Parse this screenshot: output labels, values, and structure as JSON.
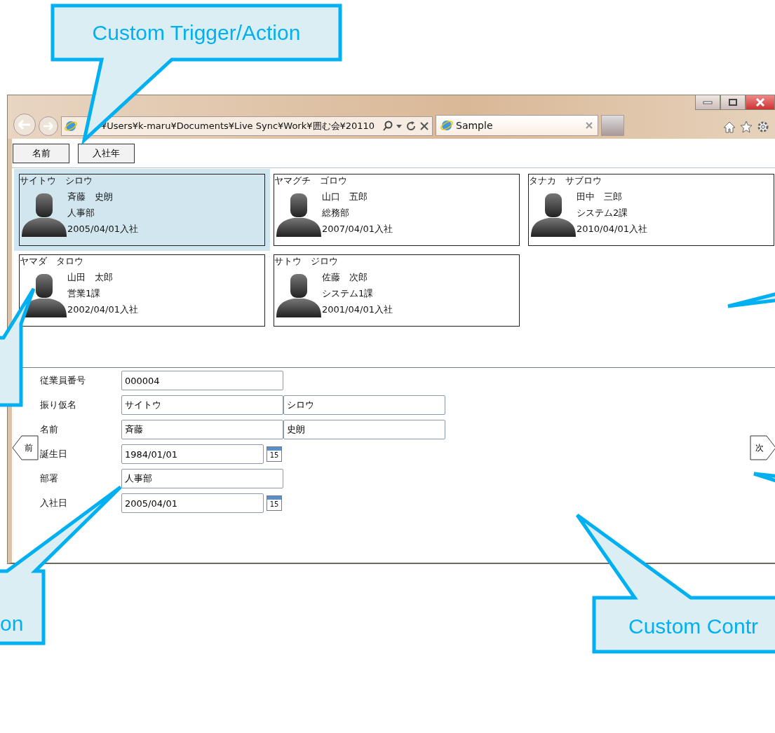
{
  "browser": {
    "address": "¥Users¥k-maru¥Documents¥Live Sync¥Work¥囲む会¥20110",
    "tab": {
      "title": "Sample",
      "selected": true
    }
  },
  "sort_buttons": [
    {
      "label": "名前"
    },
    {
      "label": "入社年"
    }
  ],
  "employees": [
    {
      "kana": "サイトウ　シロウ",
      "name": "斉藤　史朗",
      "department": "人事部",
      "joined": "2005/04/01入社",
      "selected": true
    },
    {
      "kana": "ヤマグチ　ゴロウ",
      "name": "山口　五郎",
      "department": "総務部",
      "joined": "2007/04/01入社",
      "selected": false
    },
    {
      "kana": "タナカ　サブロウ",
      "name": "田中　三郎",
      "department": "システム2課",
      "joined": "2010/04/01入社",
      "selected": false
    },
    {
      "kana": "ヤマダ　タロウ",
      "name": "山田　太郎",
      "department": "営業1課",
      "joined": "2002/04/01入社",
      "selected": false
    },
    {
      "kana": "サトウ　ジロウ",
      "name": "佐藤　次郎",
      "department": "システム1課",
      "joined": "2001/04/01入社",
      "selected": false
    }
  ],
  "form": {
    "fields": [
      {
        "label": "従業員番号",
        "values": [
          "000004"
        ],
        "kind": "text"
      },
      {
        "label": "振り仮名",
        "values": [
          "サイトウ",
          "シロウ"
        ],
        "kind": "text"
      },
      {
        "label": "名前",
        "values": [
          "斉藤",
          "史朗"
        ],
        "kind": "text"
      },
      {
        "label": "誕生日",
        "values": [
          "1984/01/01"
        ],
        "kind": "date",
        "calendar_text": "15"
      },
      {
        "label": "部署",
        "values": [
          "人事部"
        ],
        "kind": "text"
      },
      {
        "label": "入社日",
        "values": [
          "2005/04/01"
        ],
        "kind": "date",
        "calendar_text": "15"
      }
    ]
  },
  "pager": {
    "previous": "前",
    "next": "次"
  },
  "callouts": [
    {
      "kind": "top",
      "text": "Custom Trigger/Action"
    },
    {
      "kind": "left"
    },
    {
      "kind": "bottom-left",
      "text": "on"
    },
    {
      "kind": "bottom-right",
      "text": "Custom Contr"
    },
    {
      "kind": "right"
    }
  ]
}
